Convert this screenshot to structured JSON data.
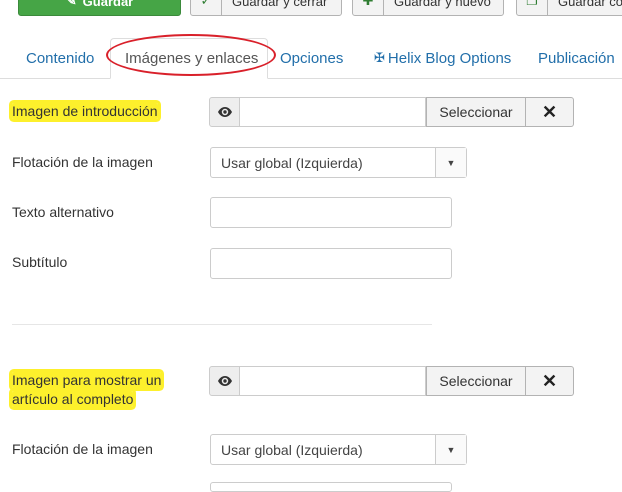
{
  "toolbar": {
    "save_label": "Guardar",
    "save_close_label": "Guardar y cerrar",
    "save_new_label": "Guardar y nuevo",
    "save_copy_label": "Guardar co"
  },
  "tabs": [
    {
      "label": "Contenido"
    },
    {
      "label": "Imágenes y enlaces",
      "active": true
    },
    {
      "label": "Opciones"
    },
    {
      "label": "Helix Blog Options",
      "icon": "joomla-icon"
    },
    {
      "label": "Publicación"
    }
  ],
  "intro_image": {
    "label": "Imagen de introducción",
    "path_value": "",
    "select_label": "Seleccionar",
    "clear_icon": "x-icon",
    "preview_icon": "eye-icon"
  },
  "intro_float": {
    "label": "Flotación de la imagen",
    "value": "Usar global (Izquierda)"
  },
  "alt_text": {
    "label": "Texto alternativo",
    "value": ""
  },
  "caption": {
    "label": "Subtítulo",
    "value": ""
  },
  "full_image": {
    "label_line1": "Imagen para mostrar un",
    "label_line2": "artículo al completo",
    "path_value": "",
    "select_label": "Seleccionar",
    "clear_icon": "x-icon",
    "preview_icon": "eye-icon"
  },
  "full_float": {
    "label": "Flotación de la imagen",
    "value": "Usar global (Izquierda)"
  },
  "colors": {
    "save_green": "#46a546",
    "link_blue": "#226faa",
    "highlight_yellow": "#fdf02c",
    "annotation_red": "#d9202a"
  }
}
